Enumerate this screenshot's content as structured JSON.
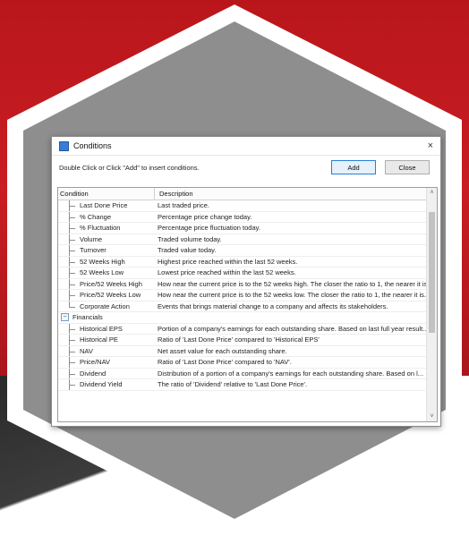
{
  "window": {
    "title": "Conditions",
    "close_glyph": "×"
  },
  "toolbar": {
    "hint": "Double Click or Click \"Add\" to insert conditions.",
    "add_label": "Add",
    "close_label": "Close"
  },
  "grid": {
    "columns": [
      "Condition",
      "Description"
    ],
    "rows": [
      {
        "type": "leaf",
        "condition": "Last Done Price",
        "description": "Last traded price."
      },
      {
        "type": "leaf",
        "condition": "% Change",
        "description": "Percentage price change today."
      },
      {
        "type": "leaf",
        "condition": "% Fluctuation",
        "description": "Percentage price fluctuation today."
      },
      {
        "type": "leaf",
        "condition": "Volume",
        "description": "Traded volume today."
      },
      {
        "type": "leaf",
        "condition": "Turnover",
        "description": "Traded value today."
      },
      {
        "type": "leaf",
        "condition": "52 Weeks High",
        "description": "Highest price reached within the last 52 weeks."
      },
      {
        "type": "leaf",
        "condition": "52 Weeks Low",
        "description": "Lowest price reached within the last 52 weeks."
      },
      {
        "type": "leaf",
        "condition": "Price/52 Weeks High",
        "description": "How near the current price is to the 52 weeks high. The closer the ratio to 1, the nearer it is."
      },
      {
        "type": "leaf",
        "condition": "Price/52 Weeks Low",
        "description": "How near the current price is to the 52 weeks low. The closer the ratio to 1, the nearer it is."
      },
      {
        "type": "leaf-end",
        "condition": "Corporate Action",
        "description": "Events that brings material change to a company and affects its stakeholders."
      },
      {
        "type": "group",
        "condition": "Financials",
        "description": "",
        "expander": "−"
      },
      {
        "type": "leaf",
        "condition": "Historical EPS",
        "description": "Portion of a company's earnings for each outstanding share. Based on last full year result..."
      },
      {
        "type": "leaf",
        "condition": "Historical PE",
        "description": "Ratio of 'Last Done Price' compared to 'Historical EPS'"
      },
      {
        "type": "leaf",
        "condition": "NAV",
        "description": "Net asset value for each outstanding share."
      },
      {
        "type": "leaf",
        "condition": "Price/NAV",
        "description": "Ratio of 'Last Done Price' compared to 'NAV'."
      },
      {
        "type": "leaf",
        "condition": "Dividend",
        "description": "Distribution of a portion of a company's earnings for each outstanding share. Based on l..."
      },
      {
        "type": "leaf",
        "condition": "Dividend Yield",
        "description": "The ratio of 'Dividend' relative to 'Last Done Price'."
      }
    ]
  },
  "scrollbar": {
    "up_glyph": "˄",
    "down_glyph": "˅"
  },
  "colors": {
    "background_red": "#c81d22",
    "hexagon_gray": "#8e8e8e",
    "button_accent": "#2a7fd4"
  }
}
